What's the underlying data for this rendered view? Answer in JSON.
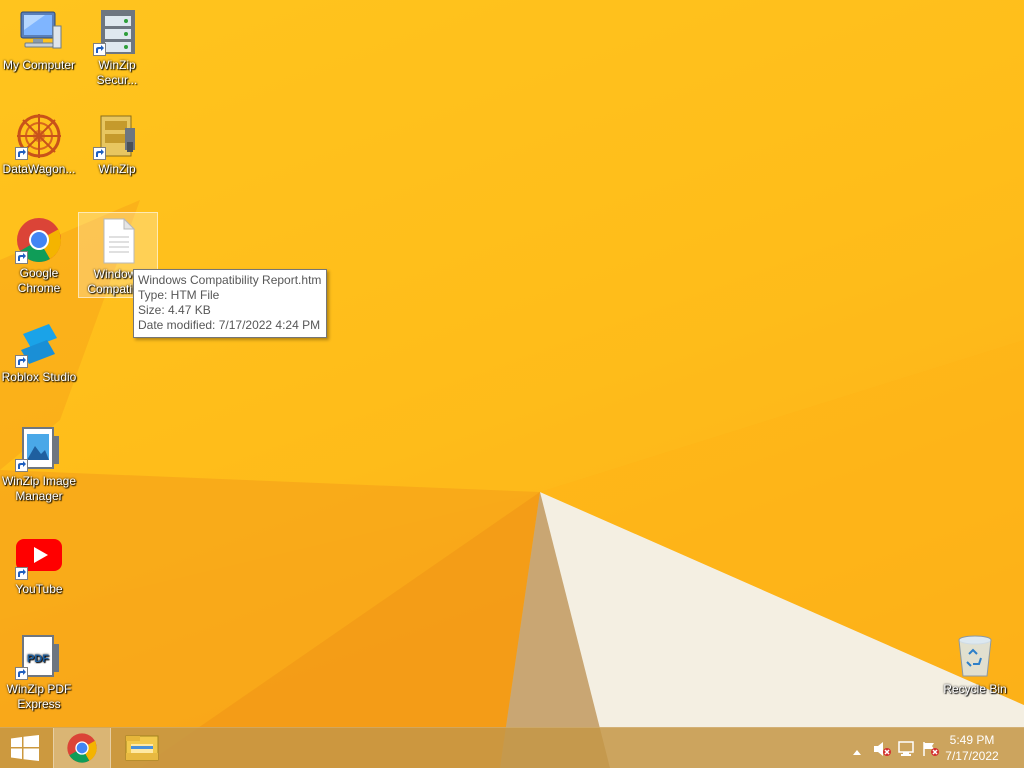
{
  "desktop": {
    "icons": [
      {
        "id": "my-computer",
        "label": "My Computer"
      },
      {
        "id": "winzip-secure",
        "label": "WinZip Secur..."
      },
      {
        "id": "datawagon",
        "label": "DataWagon..."
      },
      {
        "id": "winzip",
        "label": "WinZip"
      },
      {
        "id": "google-chrome",
        "label": "Google Chrome"
      },
      {
        "id": "windows-compat",
        "label": "Windows Compatib..."
      },
      {
        "id": "roblox-studio",
        "label": "Roblox Studio"
      },
      {
        "id": "winzip-image",
        "label": "WinZip Image Manager"
      },
      {
        "id": "youtube",
        "label": "YouTube"
      },
      {
        "id": "winzip-pdf",
        "label": "WinZip PDF Express"
      },
      {
        "id": "recycle-bin",
        "label": "Recycle Bin"
      }
    ]
  },
  "tooltip": {
    "name": "Windows Compatibility Report.htm",
    "type": "Type: HTM File",
    "size": "Size: 4.47 KB",
    "modified": "Date modified: 7/17/2022 4:24 PM"
  },
  "taskbar": {
    "start_icon": "windows-logo-icon",
    "pinned": [
      "chrome-icon",
      "file-explorer-icon"
    ],
    "tray_icons": [
      "show-hidden-icons-arrow",
      "volume-muted-icon",
      "network-icon",
      "action-center-flag-icon"
    ],
    "clock": {
      "time": "5:49 PM",
      "date": "7/17/2022"
    }
  },
  "colors": {
    "wallpaper": "#ffbb1a",
    "taskbar": "#c4964a",
    "tooltip_bg": "#ffffff"
  }
}
